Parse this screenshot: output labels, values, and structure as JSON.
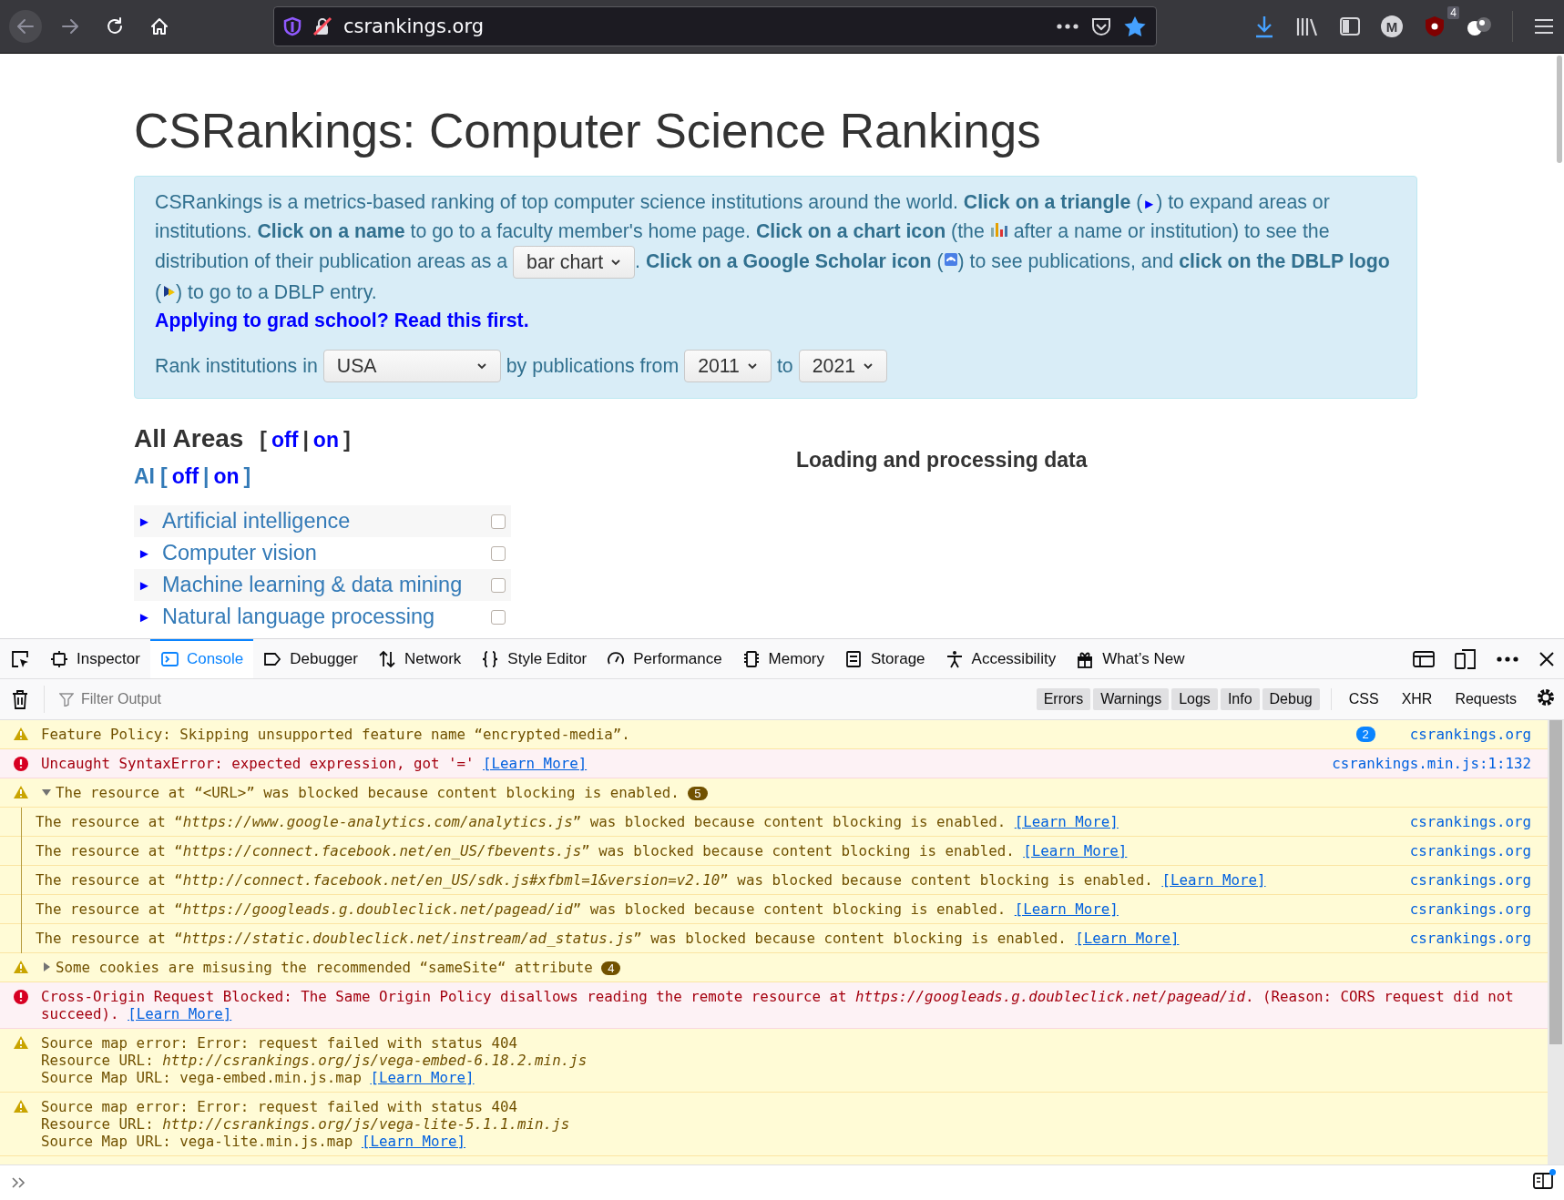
{
  "browser": {
    "url": "csrankings.org",
    "avatar": "M",
    "addon_badge": "4"
  },
  "page": {
    "title": "CSRankings: Computer Science Rankings",
    "intro": [
      {
        "kind": "text",
        "text": "CSRankings is a metrics-based ranking of top computer science institutions around the world. **Click on a triangle** ("
      },
      {
        "kind": "glyph",
        "text": "►"
      },
      {
        "kind": "text",
        "text": ") to expand areas or institutions. **Click on a name** to go to a faculty member's home page. **Click on a chart icon** (the "
      },
      {
        "kind": "chart_icon"
      },
      {
        "kind": "text",
        "text": " after a name or institution) to see the distribution of their publication areas as a "
      },
      {
        "kind": "select",
        "text": "bar chart"
      },
      {
        "kind": "text",
        "text": ". **Click on a Google Scholar icon** ("
      },
      {
        "kind": "scholar_icon"
      },
      {
        "kind": "text",
        "text": ") to see publications, and **click on the DBLP logo** ("
      },
      {
        "kind": "dblp_icon"
      },
      {
        "kind": "text",
        "text": ") to go to a DBLP entry."
      }
    ],
    "apply_link": "Applying to grad school? Read this first.",
    "rank_row": [
      {
        "kind": "text",
        "text": "Rank institutions in"
      },
      {
        "kind": "region_select",
        "text": "USA"
      },
      {
        "kind": "text",
        "text": "by publications from"
      },
      {
        "kind": "year_select",
        "text": "2011"
      },
      {
        "kind": "text",
        "text": "to"
      },
      {
        "kind": "year_select",
        "text": "2021"
      }
    ],
    "all_areas": {
      "title": "All Areas",
      "toggle": [
        {
          "kind": "punct",
          "text": "["
        },
        {
          "kind": "link",
          "text": "off"
        },
        {
          "kind": "punct",
          "text": "|"
        },
        {
          "kind": "link",
          "text": "on"
        },
        {
          "kind": "punct",
          "text": "]"
        }
      ]
    },
    "ai": {
      "title": "AI",
      "toggle": [
        {
          "kind": "punct",
          "text": "["
        },
        {
          "kind": "link",
          "text": "off"
        },
        {
          "kind": "punct",
          "text": "|"
        },
        {
          "kind": "link",
          "text": "on"
        },
        {
          "kind": "punct",
          "text": "]"
        }
      ]
    },
    "areas": [
      {
        "arrow": "►",
        "label": "Artificial intelligence",
        "checked": false
      },
      {
        "arrow": "►",
        "label": "Computer vision",
        "checked": false
      },
      {
        "arrow": "►",
        "label": "Machine learning & data mining",
        "checked": false
      },
      {
        "arrow": "►",
        "label": "Natural language processing",
        "checked": false
      }
    ],
    "loading": "Loading and processing data"
  },
  "devtools": {
    "tabs": [
      {
        "label": "Inspector",
        "selected": false
      },
      {
        "label": "Console",
        "selected": true
      },
      {
        "label": "Debugger",
        "selected": false
      },
      {
        "label": "Network",
        "selected": false
      },
      {
        "label": "Style Editor",
        "selected": false
      },
      {
        "label": "Performance",
        "selected": false
      },
      {
        "label": "Memory",
        "selected": false
      },
      {
        "label": "Storage",
        "selected": false
      },
      {
        "label": "Accessibility",
        "selected": false
      },
      {
        "label": "What’s New",
        "selected": false
      }
    ],
    "filter": {
      "placeholder": "Filter Output"
    },
    "levels": [
      {
        "label": "Errors",
        "selected": true
      },
      {
        "label": "Warnings",
        "selected": true
      },
      {
        "label": "Logs",
        "selected": true
      },
      {
        "label": "Info",
        "selected": true
      },
      {
        "label": "Debug",
        "selected": true
      }
    ],
    "types": [
      {
        "label": "CSS",
        "selected": false
      },
      {
        "label": "XHR",
        "selected": false
      },
      {
        "label": "Requests",
        "selected": false
      }
    ],
    "messages": [
      {
        "kind": "warning",
        "lines": [
          "Feature Policy: Skipping unsupported feature name “encrypted-media”."
        ],
        "repeat": "2",
        "source": "csrankings.org"
      },
      {
        "kind": "error",
        "lines": [
          "Uncaught SyntaxError: expected expression, got '='"
        ],
        "link": "[Learn More]",
        "source": "csrankings.min.js:1:132"
      },
      {
        "kind": "warning",
        "expanded": true,
        "lines": [
          "The resource at “<URL>” was blocked because content blocking is enabled."
        ],
        "count": "5",
        "children": [
          {
            "lines": [
              "The resource at “*https://www.google-analytics.com/analytics.js*” was blocked because content blocking is enabled."
            ],
            "link": "[Learn More]",
            "source": "csrankings.org"
          },
          {
            "lines": [
              "The resource at “*https://connect.facebook.net/en_US/fbevents.js*” was blocked because content blocking is enabled."
            ],
            "link": "[Learn More]",
            "source": "csrankings.org"
          },
          {
            "lines": [
              "The resource at “*http://connect.facebook.net/en_US/sdk.js#xfbml=1&version=v2.10*” was blocked because content blocking is enabled."
            ],
            "link": "[Learn More]",
            "source": "csrankings.org"
          },
          {
            "lines": [
              "The resource at “*https://googleads.g.doubleclick.net/pagead/id*” was blocked because content blocking is enabled."
            ],
            "link": "[Learn More]",
            "source": "csrankings.org"
          },
          {
            "lines": [
              "The resource at “*https://static.doubleclick.net/instream/ad_status.js*” was blocked because content blocking is enabled."
            ],
            "link": "[Learn More]",
            "source": "csrankings.org"
          }
        ]
      },
      {
        "kind": "warning",
        "expanded": false,
        "lines": [
          "Some cookies are misusing the recommended “sameSite“ attribute"
        ],
        "count": "4"
      },
      {
        "kind": "error",
        "lines": [
          "Cross-Origin Request Blocked: The Same Origin Policy disallows reading the remote resource at *https://googleads.g.doubleclick.net/pagead/id*. (Reason: CORS request did not succeed)."
        ],
        "link": "[Learn More]"
      },
      {
        "kind": "warning",
        "lines": [
          "Source map error: Error: request failed with status 404",
          "Resource URL: *http://csrankings.org/js/vega-embed-6.18.2.min.js*",
          "Source Map URL: vega-embed.min.js.map"
        ],
        "link": "[Learn More]"
      },
      {
        "kind": "warning",
        "lines": [
          "Source map error: Error: request failed with status 404",
          "Resource URL: *http://csrankings.org/js/vega-lite-5.1.1.min.js*",
          "Source Map URL: vega-lite.min.js.map"
        ],
        "link": "[Learn More]"
      }
    ]
  }
}
